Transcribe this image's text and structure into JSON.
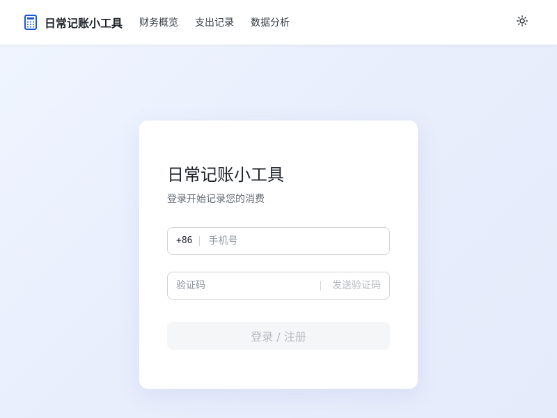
{
  "header": {
    "app_name": "日常记账小工具",
    "logo_icon": "calculator-icon",
    "nav": [
      {
        "label": "财务概览"
      },
      {
        "label": "支出记录"
      },
      {
        "label": "数据分析"
      }
    ],
    "theme_icon": "sun-icon"
  },
  "login": {
    "title": "日常记账小工具",
    "subtitle": "登录开始记录您的消费",
    "phone_prefix": "+86",
    "phone_placeholder": "手机号",
    "code_placeholder": "验证码",
    "send_code_label": "发送验证码",
    "submit_label": "登录 / 注册"
  },
  "colors": {
    "brand_icon": "#1a57d6",
    "background": "#eaf0fd",
    "disabled_text": "#b6bac0"
  }
}
